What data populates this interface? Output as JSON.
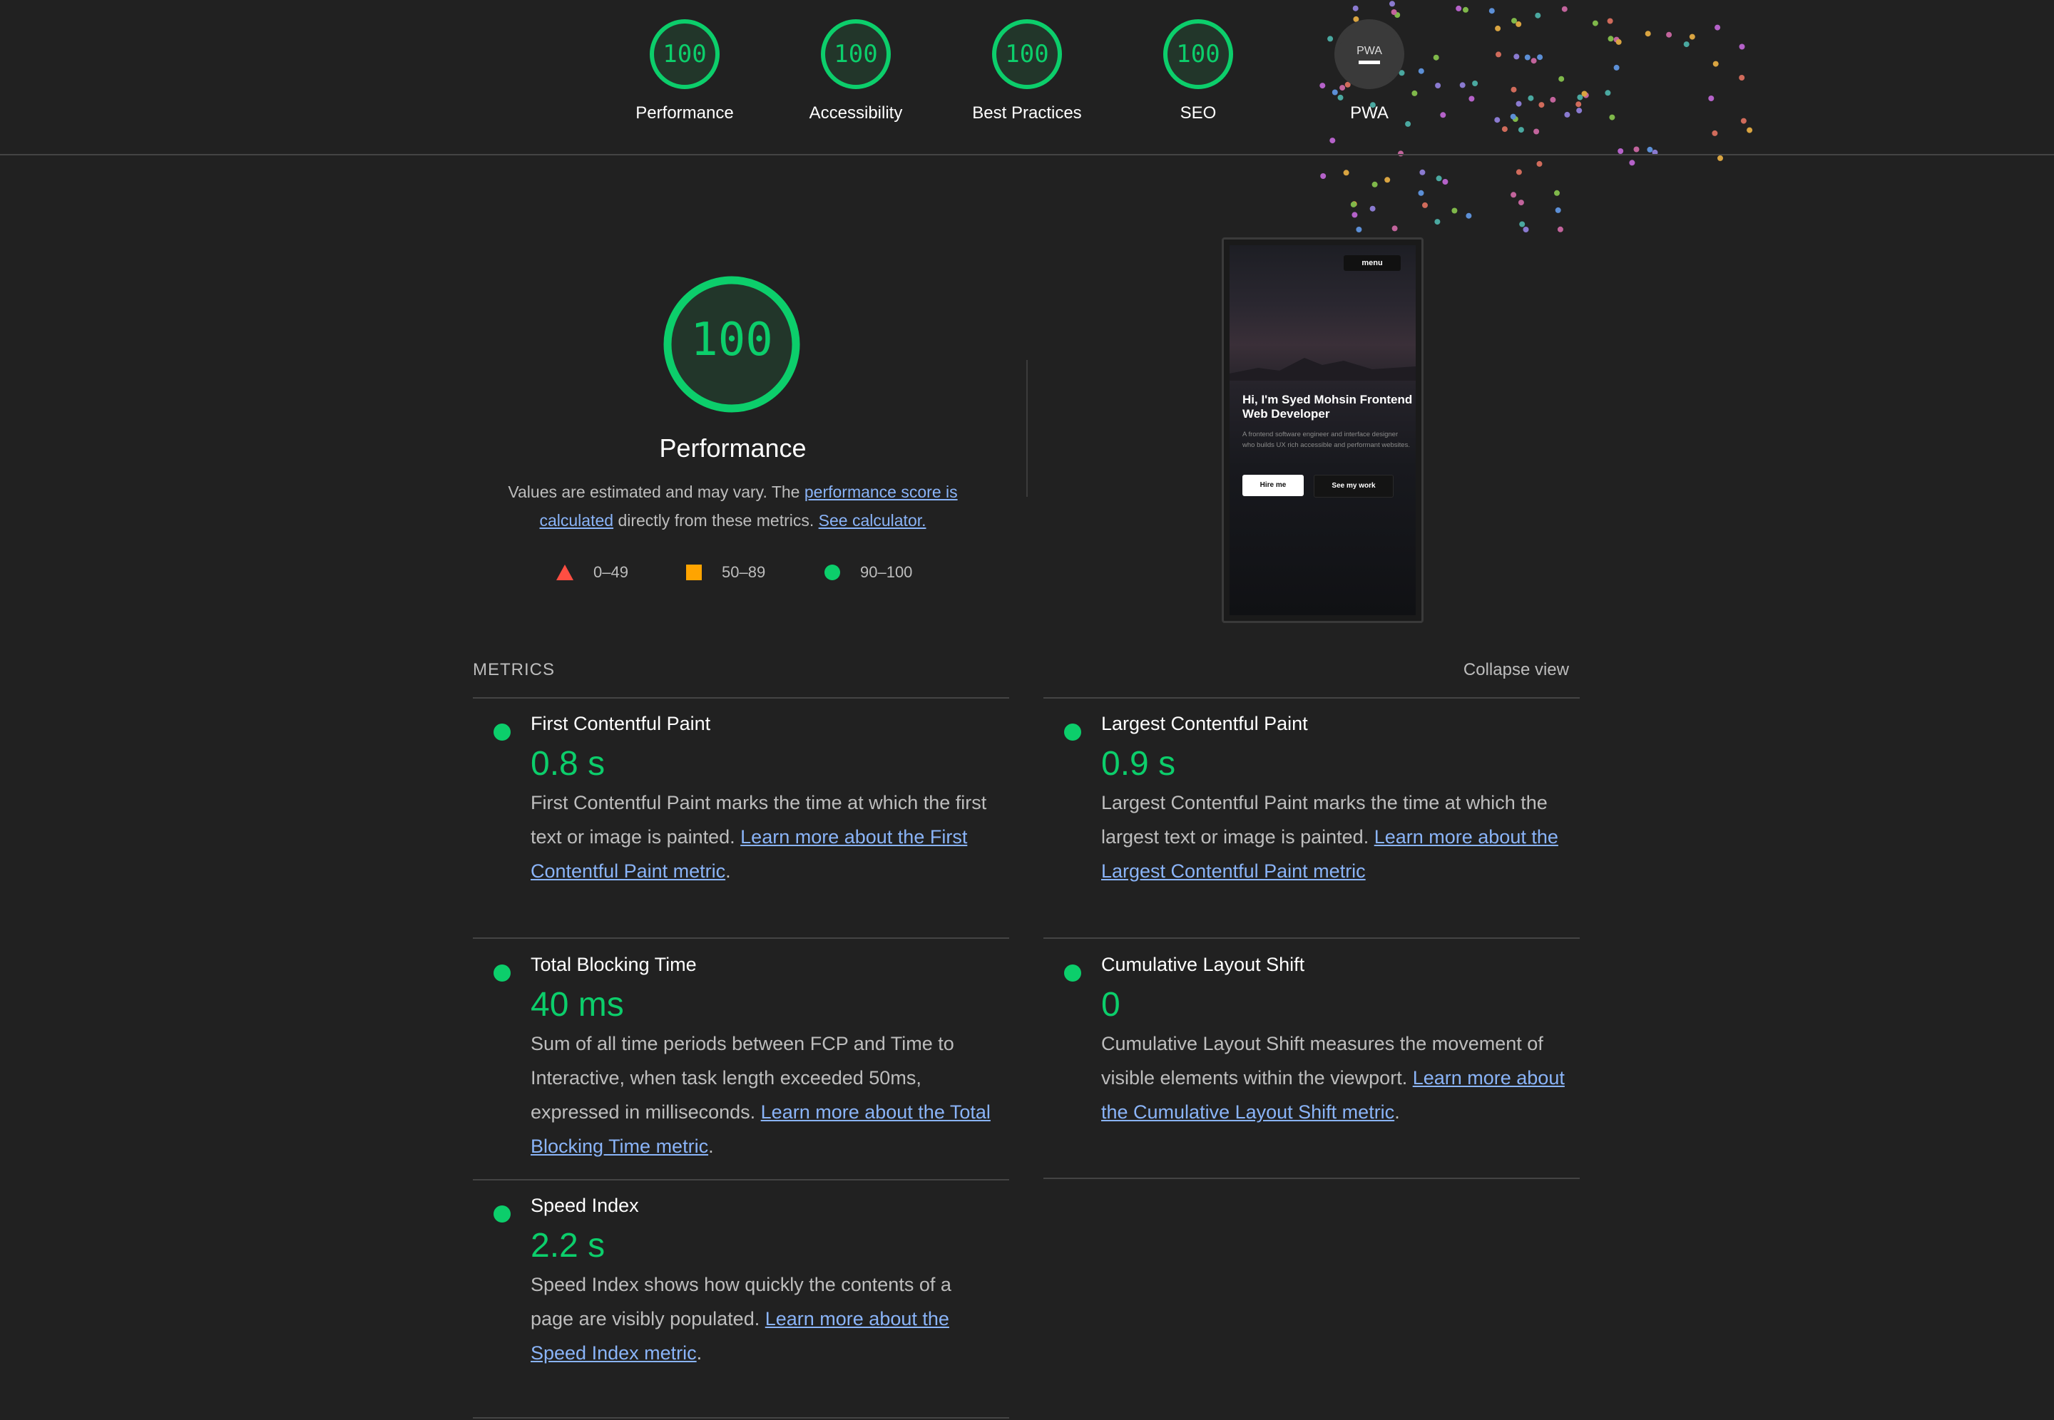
{
  "colors": {
    "pass": "#0cce6b",
    "average": "#ffa400",
    "fail": "#ff4e42",
    "link": "#8ab4f8",
    "background": "#212121"
  },
  "categories": [
    {
      "label": "Performance",
      "score": "100"
    },
    {
      "label": "Accessibility",
      "score": "100"
    },
    {
      "label": "Best Practices",
      "score": "100"
    },
    {
      "label": "SEO",
      "score": "100"
    },
    {
      "label": "PWA",
      "badge": "PWA",
      "icon": "pwa-badge-icon"
    }
  ],
  "performance": {
    "score": "100",
    "title": "Performance",
    "desc_prefix": "Values are estimated and may vary. The ",
    "desc_link1": "performance score is calculated",
    "desc_middle": " directly from these metrics. ",
    "desc_link2": "See calculator."
  },
  "legend": [
    {
      "range": "0–49",
      "icon": "triangle-icon"
    },
    {
      "range": "50–89",
      "icon": "square-icon"
    },
    {
      "range": "90–100",
      "icon": "circle-icon"
    }
  ],
  "screenshot": {
    "menu_label": "menu",
    "headline": "Hi, I'm Syed Mohsin Frontend Web Developer",
    "paragraph": "A frontend software engineer and interface designer who builds UX rich accessible and performant websites.",
    "primary_button": "Hire me",
    "secondary_button": "See my work"
  },
  "metrics_section": {
    "heading": "METRICS",
    "toggle": "Collapse view"
  },
  "metrics": [
    {
      "name": "First Contentful Paint",
      "value": "0.8 s",
      "desc": "First Contentful Paint marks the time at which the first text or image is painted. ",
      "link": "Learn more about the First Contentful Paint metric",
      "tail": "."
    },
    {
      "name": "Largest Contentful Paint",
      "value": "0.9 s",
      "desc": "Largest Contentful Paint marks the time at which the largest text or image is painted. ",
      "link": "Learn more about the Largest Contentful Paint metric",
      "tail": ""
    },
    {
      "name": "Total Blocking Time",
      "value": "40 ms",
      "desc": "Sum of all time periods between FCP and Time to Interactive, when task length exceeded 50ms, expressed in milliseconds. ",
      "link": "Learn more about the Total Blocking Time metric",
      "tail": "."
    },
    {
      "name": "Cumulative Layout Shift",
      "value": "0",
      "desc": "Cumulative Layout Shift measures the movement of visible elements within the viewport. ",
      "link": "Learn more about the Cumulative Layout Shift metric",
      "tail": "."
    },
    {
      "name": "Speed Index",
      "value": "2.2 s",
      "desc": "Speed Index shows how quickly the contents of a page are visibly populated. ",
      "link": "Learn more about the Speed Index metric",
      "tail": "."
    }
  ]
}
